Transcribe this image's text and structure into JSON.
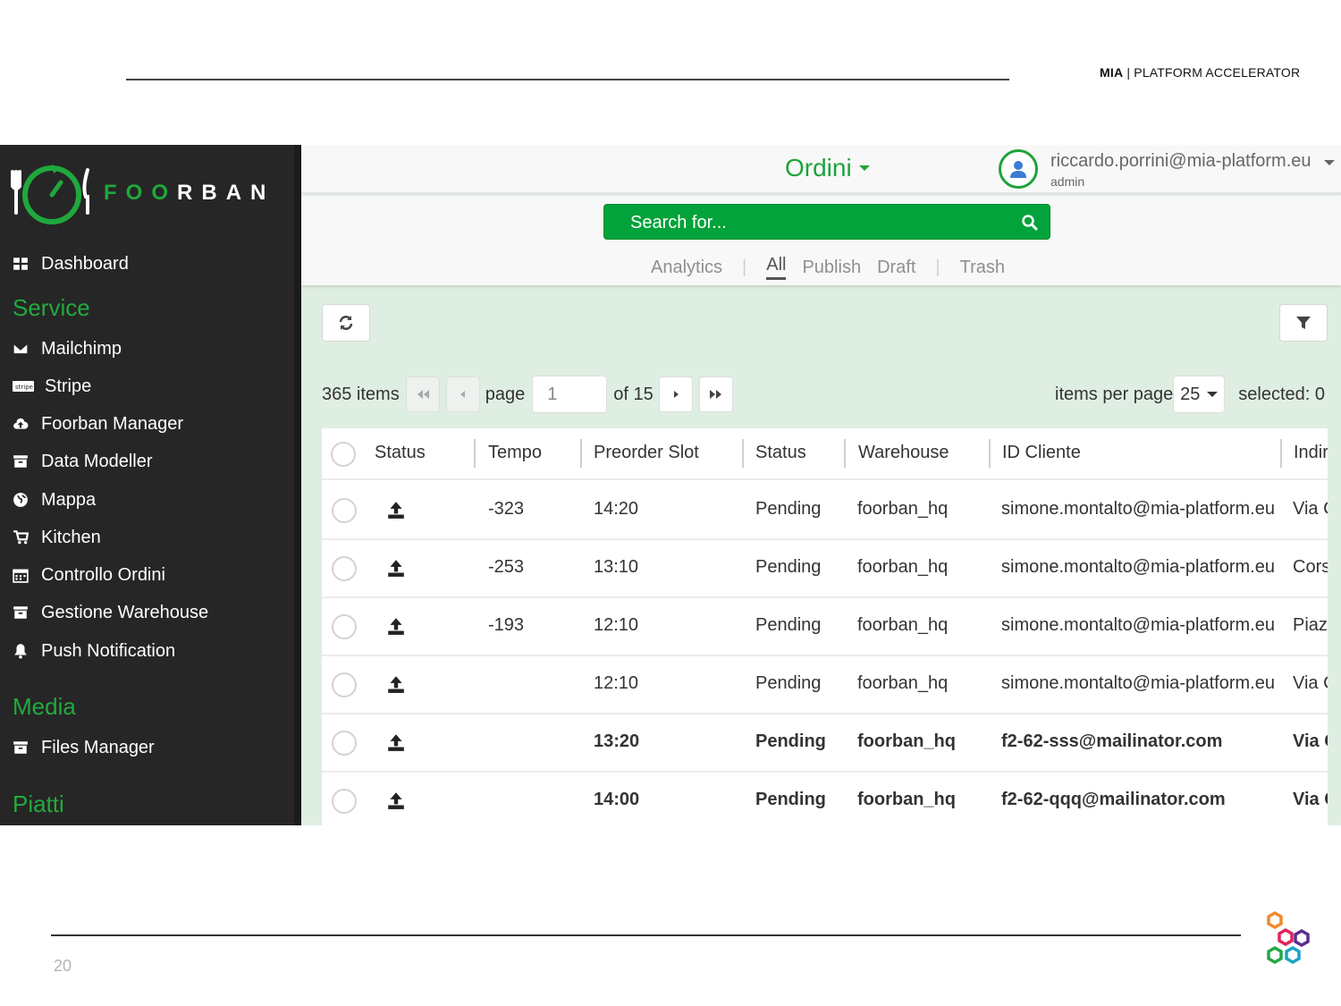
{
  "slide": {
    "brand_strong": "MIA",
    "brand_rest": " | PLATFORM ACCELERATOR",
    "page_number": "20"
  },
  "app": {
    "logo_text": "FOORBAN",
    "accent_color": "#1ea33b",
    "sidebar": {
      "items_top": [
        {
          "label": "Dashboard",
          "icon": "dashboard-icon"
        }
      ],
      "section_service": "Service",
      "service_items": [
        {
          "label": "Mailchimp",
          "icon": "envelope-icon"
        },
        {
          "label": "Stripe",
          "icon": "stripe-icon"
        },
        {
          "label": "Foorban Manager",
          "icon": "cloud-upload-icon"
        },
        {
          "label": "Data Modeller",
          "icon": "archive-icon"
        },
        {
          "label": "Mappa",
          "icon": "globe-icon"
        },
        {
          "label": "Kitchen",
          "icon": "cart-icon"
        },
        {
          "label": "Controllo Ordini",
          "icon": "calendar-icon"
        },
        {
          "label": "Gestione Warehouse",
          "icon": "archive-icon"
        },
        {
          "label": "Push Notification",
          "icon": "bell-icon"
        }
      ],
      "section_media": "Media",
      "media_items": [
        {
          "label": "Files Manager",
          "icon": "archive-icon"
        }
      ],
      "section_piatti": "Piatti"
    },
    "header": {
      "title": "Ordini",
      "user_email": "riccardo.porrini@mia-platform.eu",
      "user_role": "admin"
    },
    "search": {
      "placeholder": "Search for..."
    },
    "filters": {
      "analytics": "Analytics",
      "all": "All",
      "publish": "Publish",
      "draft": "Draft",
      "trash": "Trash"
    },
    "pagination": {
      "items_count": "365 items",
      "page_label": "page",
      "current_page": "1",
      "of_pages": "of 15",
      "ipp_label": "items per page",
      "ipp_value": "25",
      "selected": "selected: 0"
    },
    "table": {
      "columns": [
        "Status",
        "Tempo",
        "Preorder Slot",
        "Status",
        "Warehouse",
        "ID Cliente",
        "Indir"
      ],
      "rows": [
        {
          "tempo": "-323",
          "slot": "14:20",
          "status": "Pending",
          "warehouse": "foorban_hq",
          "cliente": "simone.montalto@mia-platform.eu",
          "indirizzo": "Via C"
        },
        {
          "tempo": "-253",
          "slot": "13:10",
          "status": "Pending",
          "warehouse": "foorban_hq",
          "cliente": "simone.montalto@mia-platform.eu",
          "indirizzo": "Cors"
        },
        {
          "tempo": "-193",
          "slot": "12:10",
          "status": "Pending",
          "warehouse": "foorban_hq",
          "cliente": "simone.montalto@mia-platform.eu",
          "indirizzo": "Piaz"
        },
        {
          "tempo": "",
          "slot": "12:10",
          "status": "Pending",
          "warehouse": "foorban_hq",
          "cliente": "simone.montalto@mia-platform.eu",
          "indirizzo": "Via C"
        },
        {
          "tempo": "",
          "slot": "13:20",
          "status": "Pending",
          "warehouse": "foorban_hq",
          "cliente": "f2-62-sss@mailinator.com",
          "indirizzo": "Via C",
          "bold": true
        },
        {
          "tempo": "",
          "slot": "14:00",
          "status": "Pending",
          "warehouse": "foorban_hq",
          "cliente": "f2-62-qqq@mailinator.com",
          "indirizzo": "Via C",
          "bold": true
        }
      ]
    }
  }
}
